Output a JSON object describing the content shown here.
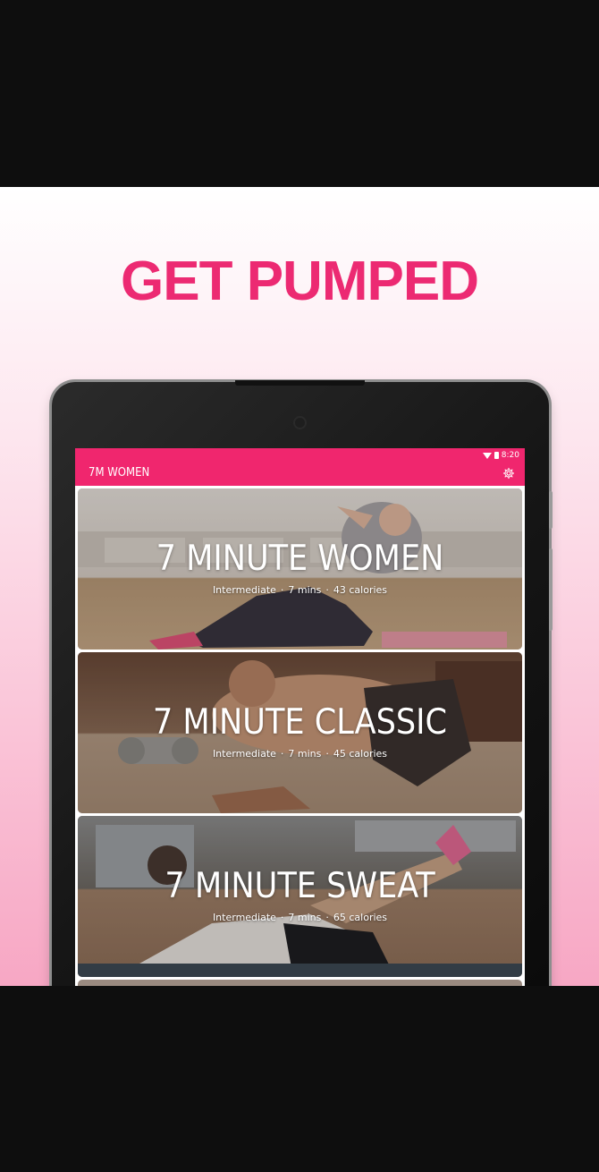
{
  "promo": {
    "headline": "GET PUMPED"
  },
  "statusbar": {
    "time": "8:20",
    "icons": [
      "wifi-icon",
      "battery-icon"
    ]
  },
  "appbar": {
    "title": "7M WOMEN",
    "settings_icon": "gear-icon"
  },
  "workouts": [
    {
      "name": "7 MINUTE WOMEN",
      "level": "Intermediate",
      "duration": "7 mins",
      "calories": "43 calories"
    },
    {
      "name": "7 MINUTE CLASSIC",
      "level": "Intermediate",
      "duration": "7 mins",
      "calories": "45 calories"
    },
    {
      "name": "7 MINUTE SWEAT",
      "level": "Intermediate",
      "duration": "7 mins",
      "calories": "65 calories"
    }
  ],
  "colors": {
    "accent": "#f0266e",
    "headline": "#ec2a72"
  }
}
